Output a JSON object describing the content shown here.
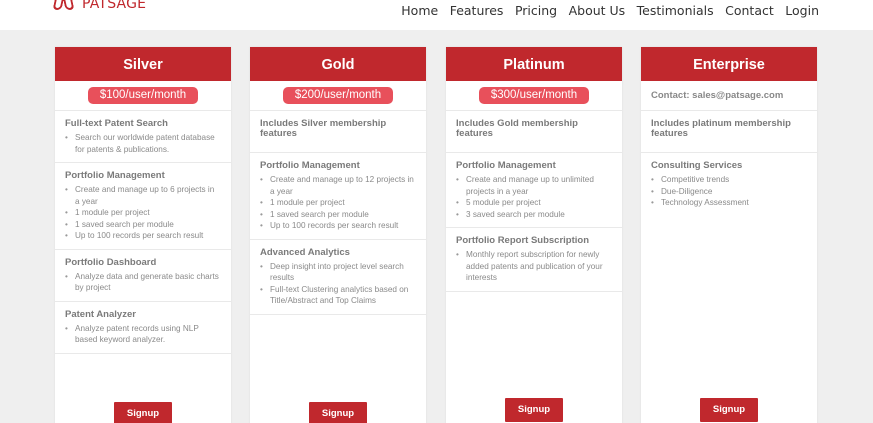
{
  "brand": {
    "name": "PATSAGE",
    "accent": "#c0282d",
    "price_pill": "#e8505b"
  },
  "nav": [
    "Home",
    "Features",
    "Pricing",
    "About Us",
    "Testimonials",
    "Contact",
    "Login"
  ],
  "plans": [
    {
      "name": "Silver",
      "price": "$100/user/month",
      "sections": [
        {
          "title": "Full-text Patent Search",
          "items": [
            "Search our worldwide patent database for patents & publications."
          ]
        },
        {
          "title": "Portfolio Management",
          "items": [
            "Create and manage up to 6 projects in a year",
            "1 module per project",
            "1 saved search per module",
            "Up to 100 records per search result"
          ]
        },
        {
          "title": "Portfolio Dashboard",
          "items": [
            "Analyze data and generate basic charts by project"
          ]
        },
        {
          "title": "Patent Analyzer",
          "items": [
            "Analyze patent records using NLP based keyword analyzer."
          ]
        }
      ],
      "signup": "Signup"
    },
    {
      "name": "Gold",
      "price": "$200/user/month",
      "sections": [
        {
          "title": "Includes Silver membership features",
          "items": []
        },
        {
          "title": "Portfolio Management",
          "items": [
            "Create and manage up to 12 projects in a year",
            "1 module per project",
            "1 saved search per module",
            "Up to 100 records per search result"
          ]
        },
        {
          "title": "Advanced Analytics",
          "items": [
            "Deep insight into project level search results",
            "Full-text Clustering analytics based on Title/Abstract and Top Claims"
          ]
        }
      ],
      "signup": "Signup"
    },
    {
      "name": "Platinum",
      "price": "$300/user/month",
      "sections": [
        {
          "title": "Includes Gold membership features",
          "items": []
        },
        {
          "title": "Portfolio Management",
          "items": [
            "Create and manage up to unlimited projects in a year",
            "5 module per project",
            "3 saved search per module"
          ]
        },
        {
          "title": "Portfolio Report Subscription",
          "items": [
            "Monthly report subscription for newly added patents and publication of your interests"
          ]
        }
      ],
      "signup": "Signup"
    },
    {
      "name": "Enterprise",
      "contact": "Contact: sales@patsage.com",
      "sections": [
        {
          "title": "Includes platinum membership features",
          "items": []
        },
        {
          "title": "Consulting Services",
          "items": [
            "Competitive trends",
            "Due-Diligence",
            "Technology Assessment"
          ]
        }
      ],
      "signup": "Signup"
    }
  ]
}
